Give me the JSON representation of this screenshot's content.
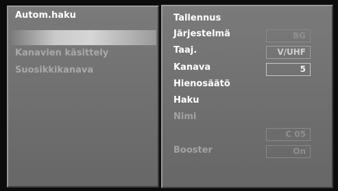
{
  "left_menu": {
    "items": [
      {
        "label": "Autom.haku",
        "state": "selected"
      },
      {
        "label": "Kanavien käsittely",
        "state": "dim"
      },
      {
        "label": "Suosikkikanava",
        "state": "dim"
      }
    ]
  },
  "right_panel": {
    "rows": [
      {
        "label": "Tallennus",
        "value": ""
      },
      {
        "label": "Järjestelmä",
        "value": "BG"
      },
      {
        "label": "Taaj.",
        "value": "V/UHF"
      },
      {
        "label": "Kanava",
        "value": "5"
      },
      {
        "label": "Hienosäätö",
        "value": ""
      },
      {
        "label": "Haku",
        "value": ""
      },
      {
        "label": "Nimi",
        "value": ""
      },
      {
        "label": "",
        "value": "C 05"
      },
      {
        "label": "Booster",
        "value": "On"
      }
    ]
  },
  "colors": {
    "panel_bg": "#757575",
    "text_bright": "#ffffff",
    "text_dim": "#a9a9a9"
  }
}
